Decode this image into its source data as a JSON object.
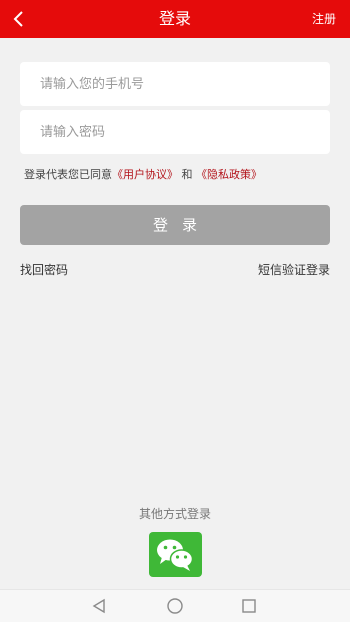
{
  "header": {
    "title": "登录",
    "register_label": "注册",
    "bg_color": "#e50b0b"
  },
  "form": {
    "phone_placeholder": "请输入您的手机号",
    "phone_value": "",
    "password_placeholder": "请输入密码",
    "password_value": ""
  },
  "agreement": {
    "prefix": "登录代表您已同意",
    "user_agreement": "《用户协议》",
    "conjunction": "和",
    "privacy_policy": "《隐私政策》"
  },
  "login_button_label": "登录",
  "links": {
    "forgot_password": "找回密码",
    "sms_login": "短信验证登录"
  },
  "other_login": {
    "label": "其他方式登录",
    "provider_icon": "wechat-icon"
  },
  "system_nav": {
    "icons": [
      "back-triangle-icon",
      "home-circle-icon",
      "recents-square-icon"
    ]
  }
}
